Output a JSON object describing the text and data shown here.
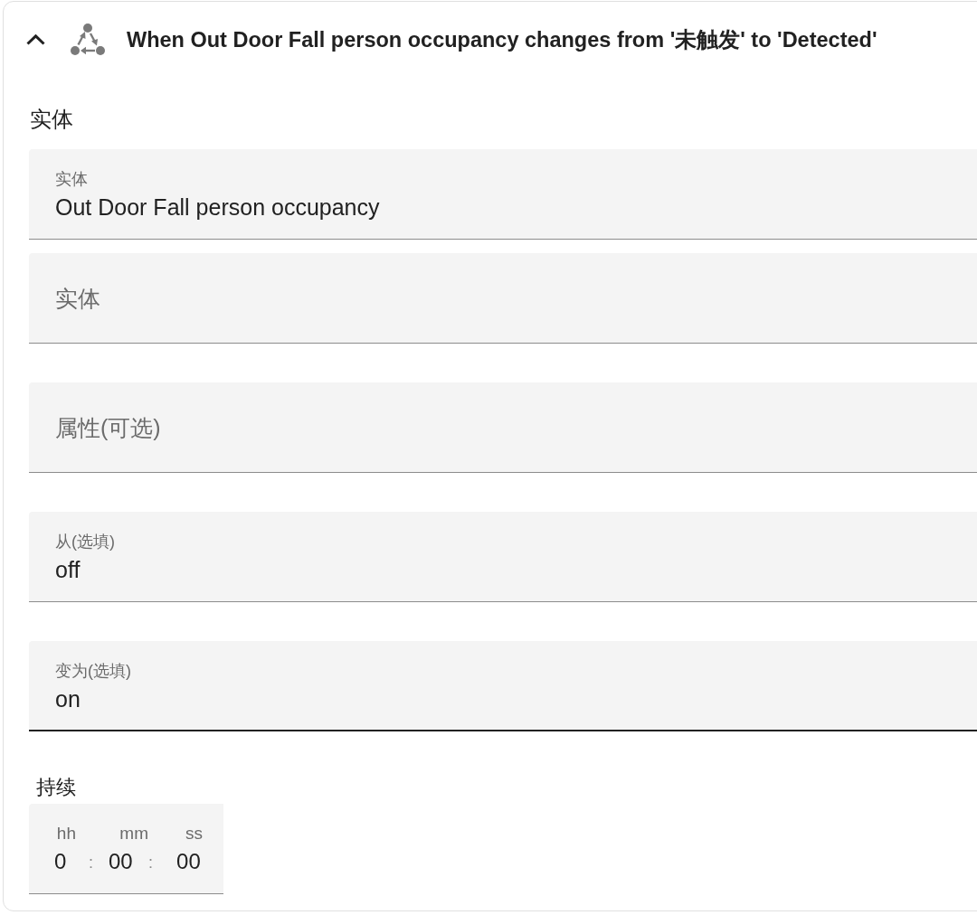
{
  "trigger": {
    "expanded": true,
    "title": "When Out Door Fall person occupancy changes from '未触发' to 'Detected'"
  },
  "entity_section": {
    "label": "实体",
    "pickers": [
      {
        "label": "实体",
        "value": "Out Door Fall person occupancy",
        "focused": false
      },
      {
        "placeholder": "实体",
        "focused": false
      }
    ]
  },
  "fields": [
    {
      "placeholder": "属性(可选)",
      "focused": false
    },
    {
      "label": "从(选填)",
      "value": "off",
      "focused": false
    },
    {
      "label": "变为(选填)",
      "value": "on",
      "focused": true
    }
  ],
  "duration": {
    "label": "持续",
    "units": [
      {
        "label": "hh",
        "value": "0"
      },
      {
        "label": "mm",
        "value": "00"
      },
      {
        "label": "ss",
        "value": "00"
      }
    ],
    "separators": [
      ":",
      ":"
    ]
  }
}
